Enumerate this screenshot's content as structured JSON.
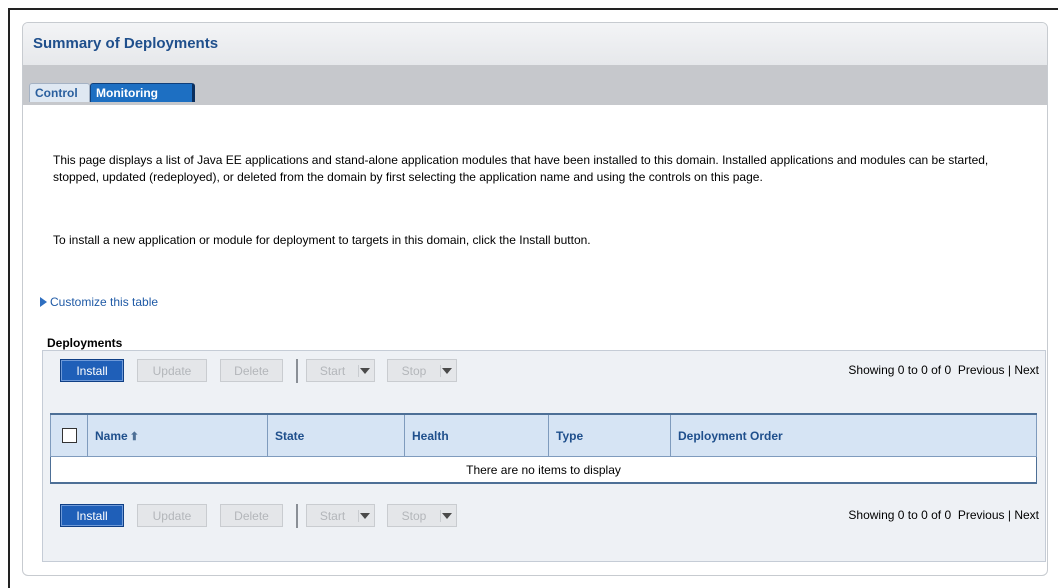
{
  "page": {
    "title": "Summary of Deployments",
    "tabs": [
      {
        "label": "Control",
        "active": false
      },
      {
        "label": "Monitoring",
        "active": true
      }
    ],
    "description": "This page displays a list of Java EE applications and stand-alone application modules that have been installed to this domain. Installed applications and modules can be started, stopped, updated (redeployed), or deleted from the domain by first selecting the application name and using the controls on this page.",
    "install_hint": "To install a new application or module for deployment to targets in this domain, click the Install button.",
    "customize_link": "Customize this table"
  },
  "table": {
    "title": "Deployments",
    "buttons": {
      "install": "Install",
      "update": "Update",
      "delete": "Delete",
      "start": "Start",
      "stop": "Stop"
    },
    "paging": {
      "summary": "Showing 0 to 0 of 0",
      "previous": "Previous",
      "separator": "|",
      "next": "Next"
    },
    "columns": [
      "Name",
      "State",
      "Health",
      "Type",
      "Deployment Order"
    ],
    "empty_message": "There are no items to display"
  },
  "colors": {
    "title": "#1f4f8c",
    "accent_button": "#1f5fb8",
    "active_tab": "#1d6fc2",
    "header_bg": "#d6e4f4"
  }
}
